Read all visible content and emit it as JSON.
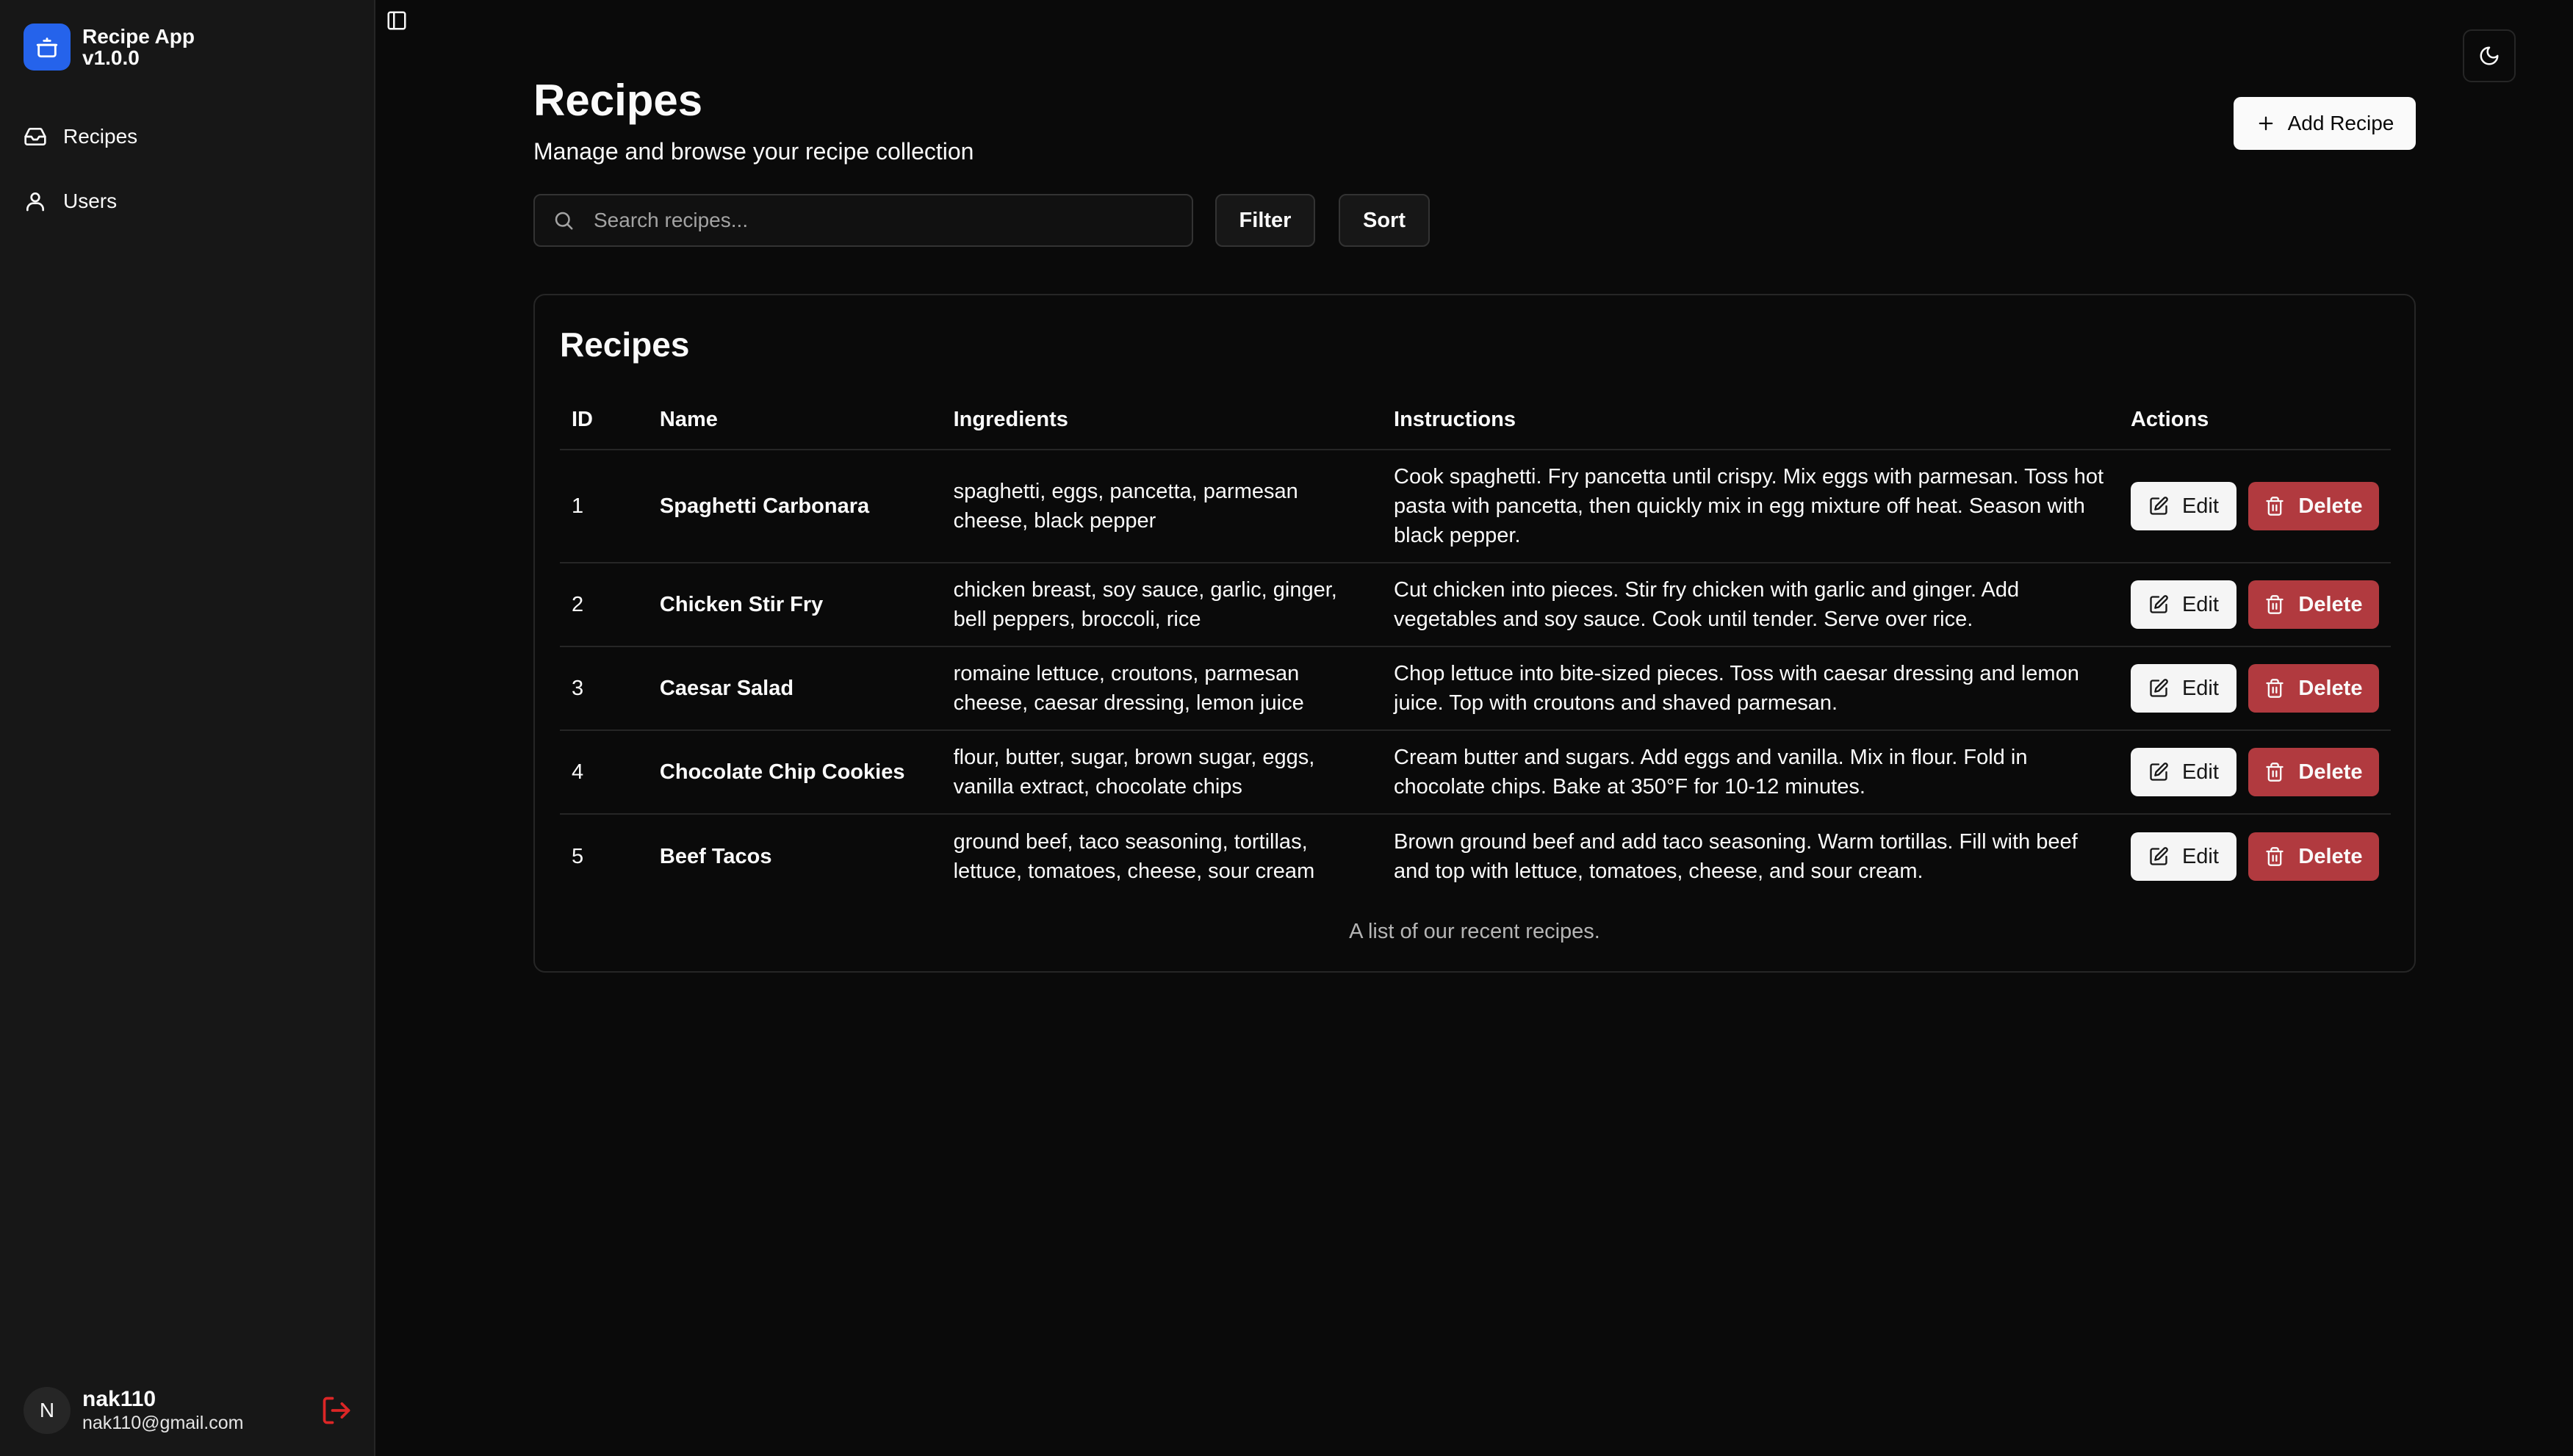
{
  "app": {
    "name": "Recipe App",
    "version": "v1.0.0",
    "brand_color": "#2563eb"
  },
  "sidebar": {
    "items": [
      {
        "label": "Recipes",
        "icon": "inbox-icon"
      },
      {
        "label": "Users",
        "icon": "user-icon"
      }
    ],
    "user": {
      "initial": "N",
      "name": "nak110",
      "email": "nak110@gmail.com"
    }
  },
  "header": {
    "title": "Recipes",
    "subtitle": "Manage and browse your recipe collection",
    "add_label": "Add Recipe"
  },
  "toolbar": {
    "search_placeholder": "Search recipes...",
    "filter_label": "Filter",
    "sort_label": "Sort"
  },
  "table": {
    "title": "Recipes",
    "columns": [
      "ID",
      "Name",
      "Ingredients",
      "Instructions",
      "Actions"
    ],
    "rows": [
      {
        "id": "1",
        "name": "Spaghetti Carbonara",
        "ingredients": "spaghetti, eggs, pancetta, parmesan cheese, black pepper",
        "instructions": "Cook spaghetti. Fry pancetta until crispy. Mix eggs with parmesan. Toss hot pasta with pancetta, then quickly mix in egg mixture off heat. Season with black pepper."
      },
      {
        "id": "2",
        "name": "Chicken Stir Fry",
        "ingredients": "chicken breast, soy sauce, garlic, ginger, bell peppers, broccoli, rice",
        "instructions": "Cut chicken into pieces. Stir fry chicken with garlic and ginger. Add vegetables and soy sauce. Cook until tender. Serve over rice."
      },
      {
        "id": "3",
        "name": "Caesar Salad",
        "ingredients": "romaine lettuce, croutons, parmesan cheese, caesar dressing, lemon juice",
        "instructions": "Chop lettuce into bite-sized pieces. Toss with caesar dressing and lemon juice. Top with croutons and shaved parmesan."
      },
      {
        "id": "4",
        "name": "Chocolate Chip Cookies",
        "ingredients": "flour, butter, sugar, brown sugar, eggs, vanilla extract, chocolate chips",
        "instructions": "Cream butter and sugars. Add eggs and vanilla. Mix in flour. Fold in chocolate chips. Bake at 350°F for 10-12 minutes."
      },
      {
        "id": "5",
        "name": "Beef Tacos",
        "ingredients": "ground beef, taco seasoning, tortillas, lettuce, tomatoes, cheese, sour cream",
        "instructions": "Brown ground beef and add taco seasoning. Warm tortillas. Fill with beef and top with lettuce, tomatoes, cheese, and sour cream."
      }
    ],
    "edit_label": "Edit",
    "delete_label": "Delete",
    "caption": "A list of our recent recipes."
  },
  "colors": {
    "background": "#0a0a0a",
    "sidebar": "#171717",
    "delete": "#b13a3f",
    "logout": "#dc2626"
  }
}
